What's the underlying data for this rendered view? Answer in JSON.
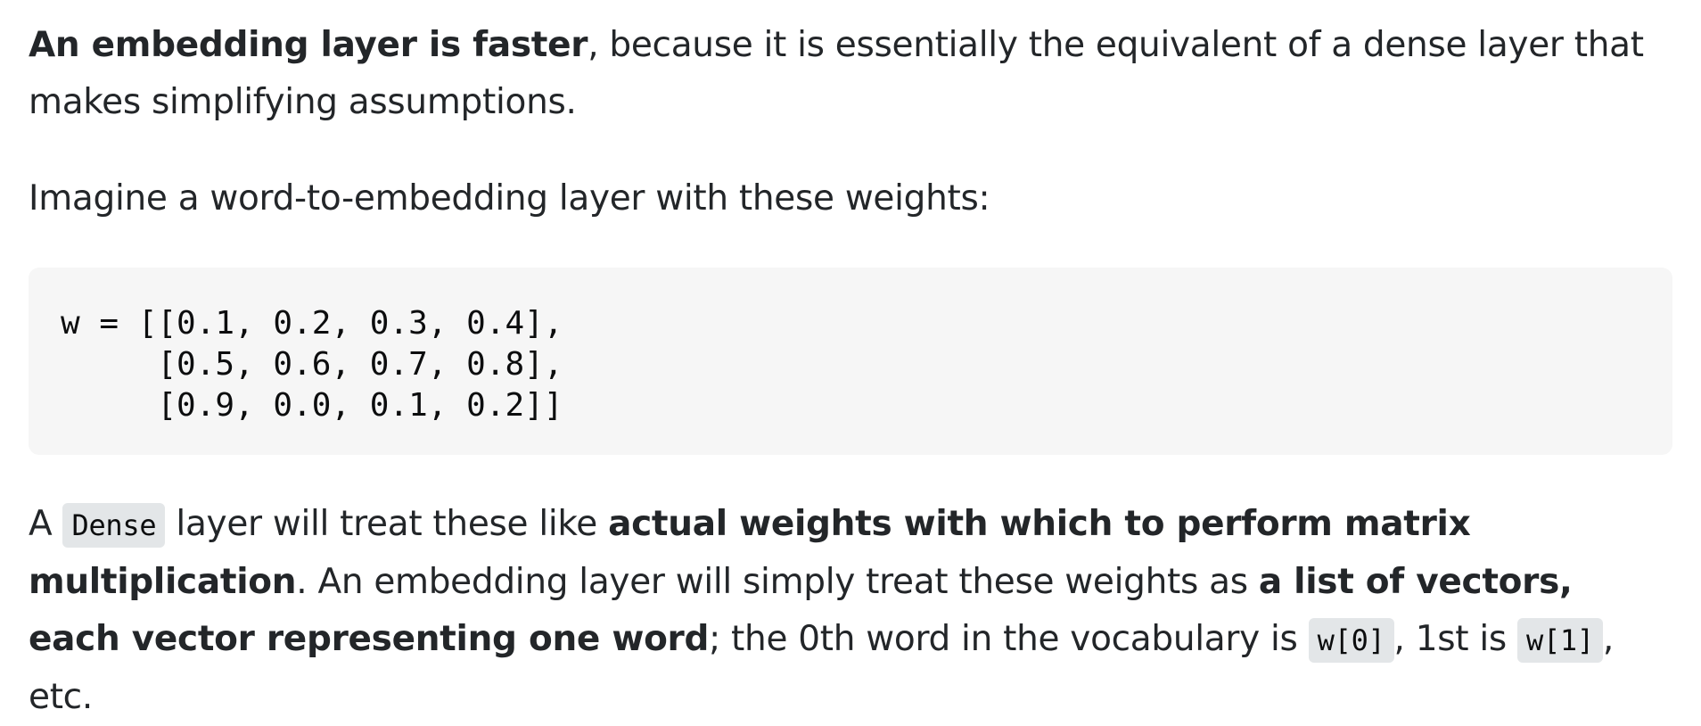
{
  "answer": {
    "p1": {
      "bold_lead": "An embedding layer is faster",
      "rest": ", because it is essentially the equivalent of a dense layer that makes simplifying assumptions."
    },
    "p2": {
      "text": "Imagine a word-to-embedding layer with these weights:"
    },
    "code": {
      "text": "w = [[0.1, 0.2, 0.3, 0.4],\n     [0.5, 0.6, 0.7, 0.8],\n     [0.9, 0.0, 0.1, 0.2]]"
    },
    "p3": {
      "t1": "A ",
      "code_dense": "Dense",
      "t2": " layer will treat these like ",
      "b1": "actual weights with which to perform matrix multiplication",
      "t3": ". An embedding layer will simply treat these weights as ",
      "b2": "a list of vectors, each vector representing one word",
      "t4": "; the 0th word in the vocabulary is ",
      "code_w0": "w[0]",
      "t5": ", 1st is ",
      "code_w1": "w[1]",
      "t6": ", etc."
    }
  }
}
